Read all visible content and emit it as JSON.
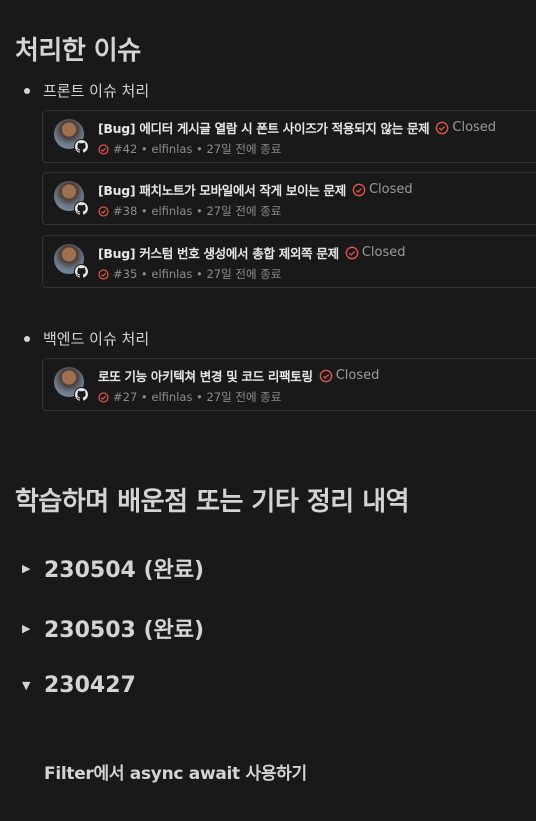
{
  "section1": {
    "title": "처리한 이슈",
    "groups": [
      {
        "label": "프론트 이슈 처리",
        "issues": [
          {
            "title": "[Bug] 에디터 게시글 열람 시 폰트 사이즈가 적용되지 않는 문제",
            "status": "Closed",
            "meta": "#42 • elfinlas • 27일 전에 종료"
          },
          {
            "title": "[Bug] 패치노트가 모바일에서 작게 보이는 문제",
            "status": "Closed",
            "meta": "#38 • elfinlas • 27일 전에 종료"
          },
          {
            "title": "[Bug] 커스텀 번호 생성에서 총합 제외쪽 문제",
            "status": "Closed",
            "meta": "#35 • elfinlas • 27일 전에 종료"
          }
        ]
      },
      {
        "label": "백엔드 이슈 처리",
        "issues": [
          {
            "title": "로또 기능 아키텍쳐 변경 및 코드 리팩토링",
            "status": "Closed",
            "meta": "#27 • elfinlas • 27일 전에 종료"
          }
        ]
      }
    ]
  },
  "section2": {
    "title": "학습하며 배운점 또는 기타 정리 내역",
    "toggles": [
      {
        "label": "230504 (완료)",
        "state": "collapsed"
      },
      {
        "label": "230503 (완료)",
        "state": "collapsed"
      },
      {
        "label": "230427",
        "state": "expanded"
      }
    ],
    "expanded_content": "Filter에서 async await 사용하기"
  },
  "icons": {
    "status": "check-circle-icon",
    "github": "github-icon",
    "collapsed": "triangle-right-icon",
    "expanded": "triangle-down-icon"
  },
  "colors": {
    "background": "#191919",
    "closed_red": "#e5534b",
    "text": "#d4d4d4"
  }
}
